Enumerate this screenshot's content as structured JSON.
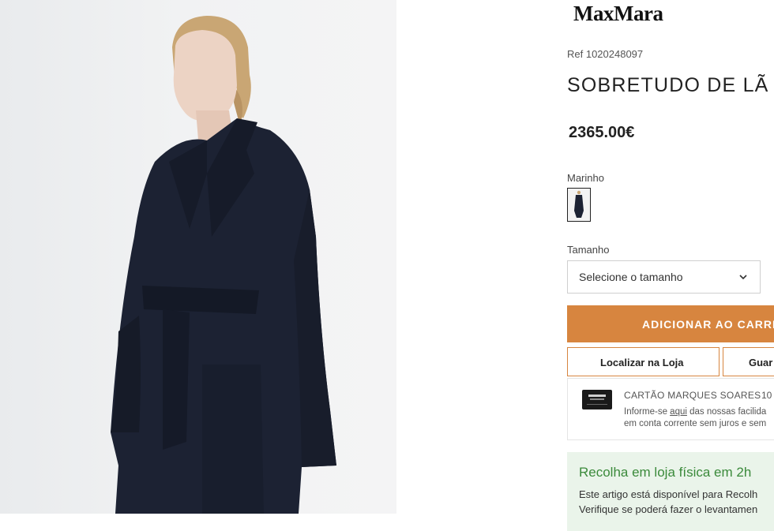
{
  "product_image": {
    "alt": "Modelo com sobretudo de lã azul marinho com cinto"
  },
  "brand": "MaxMara",
  "product": {
    "ref": "Ref 1020248097",
    "title": "SOBRETUDO DE LÃ",
    "price": "2365.00€"
  },
  "color": {
    "label": "Marinho",
    "swatch_color": "#1c2233"
  },
  "size": {
    "label": "Tamanho",
    "placeholder": "Selecione o tamanho"
  },
  "actions": {
    "add_to_cart": "ADICIONAR AO CARRI",
    "find_in_store": "Localizar na Loja",
    "save": "Guar"
  },
  "card": {
    "title": "CARTÃO MARQUES SOARES",
    "count": "10",
    "text_before_link": "Informe-se ",
    "link": "aqui",
    "text_after_link": " das nossas facilida",
    "text_line2": "em conta corrente sem juros e sem"
  },
  "pickup": {
    "title": "Recolha em loja física em 2h",
    "line1": "Este artigo está disponível para Recolh",
    "line2": "Verifique se poderá fazer o levantamen"
  },
  "colors": {
    "accent": "#d7853f",
    "pickup_bg": "#eaf4ea",
    "pickup_text": "#3b8a3b",
    "coat": "#1c2233"
  }
}
